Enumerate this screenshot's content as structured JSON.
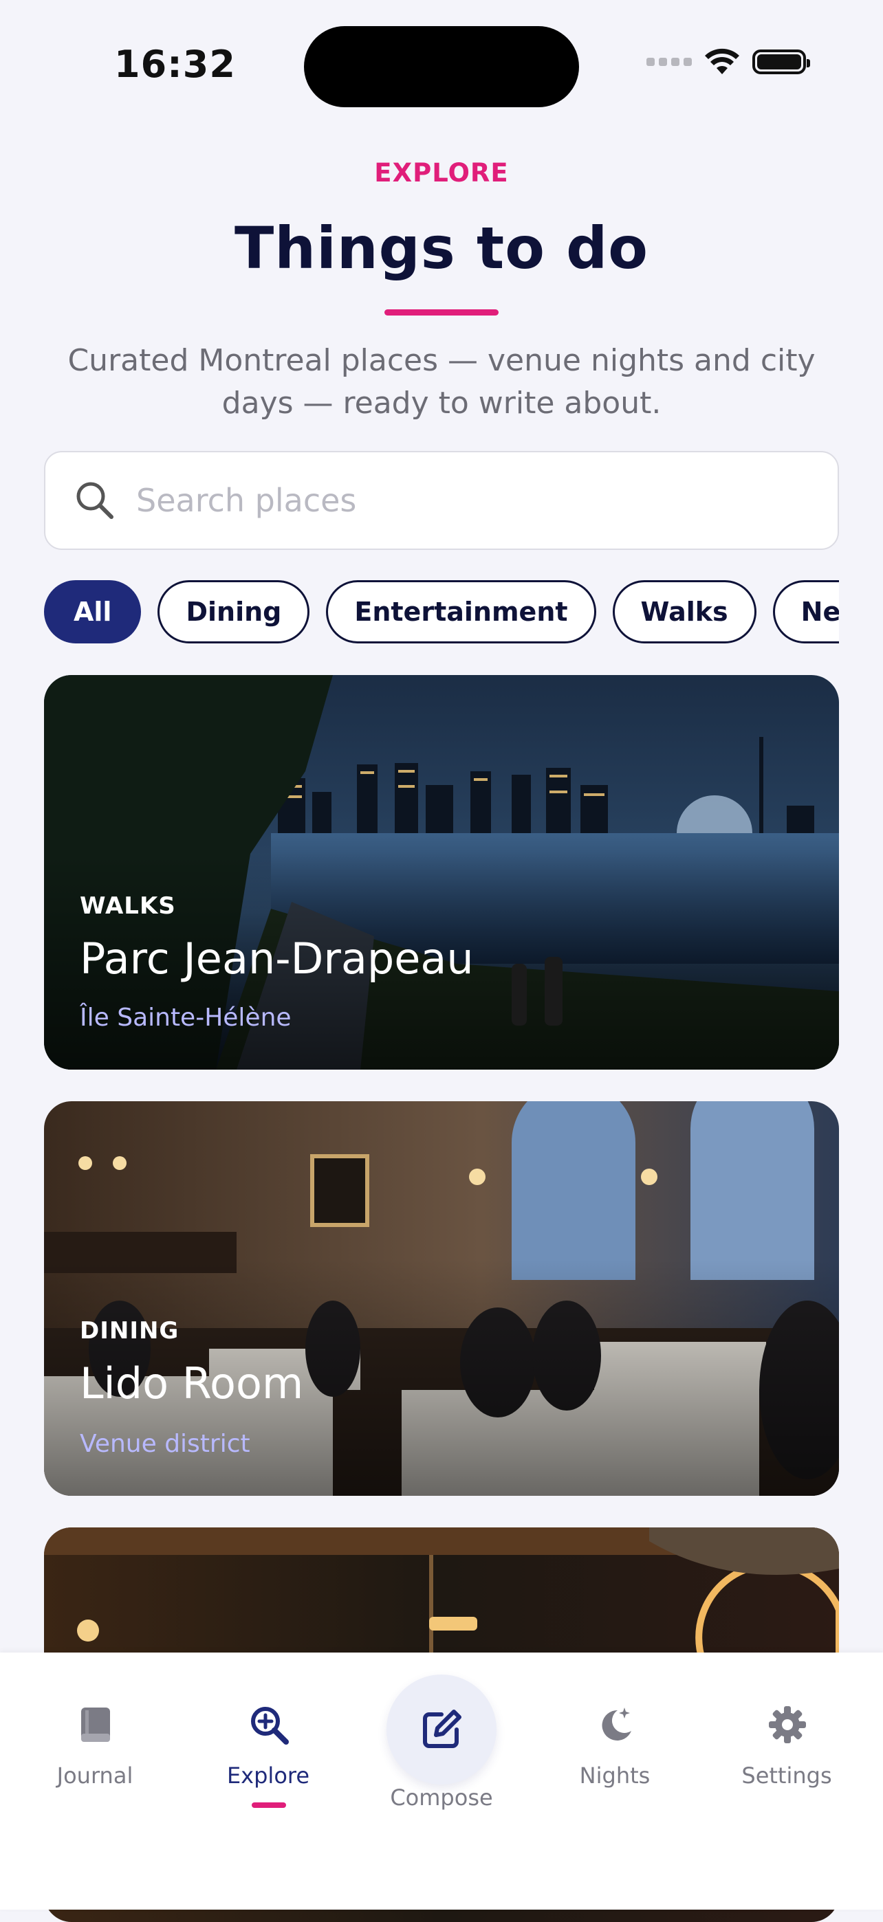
{
  "status_bar": {
    "time": "16:32"
  },
  "header": {
    "kicker": "EXPLORE",
    "title": "Things to do",
    "subtitle": "Curated Montreal places — venue nights and city days — ready to write about."
  },
  "search": {
    "placeholder": "Search places",
    "value": ""
  },
  "filters": [
    "All",
    "Dining",
    "Entertainment",
    "Walks",
    "Neighborhoods"
  ],
  "selected_filter": "All",
  "places": [
    {
      "category": "WALKS",
      "name": "Parc Jean-Drapeau",
      "location": "Île Sainte-Hélène"
    },
    {
      "category": "DINING",
      "name": "Lido Room",
      "location": "Venue district"
    }
  ],
  "tab_bar": {
    "items": [
      {
        "label": "Journal",
        "icon": "book-icon"
      },
      {
        "label": "Explore",
        "icon": "search-plus-icon",
        "active": true
      },
      {
        "label": "Compose",
        "icon": "compose-icon"
      },
      {
        "label": "Nights",
        "icon": "moon-stars-icon"
      },
      {
        "label": "Settings",
        "icon": "gear-icon"
      }
    ]
  },
  "colors": {
    "accent": "#e01e7a",
    "primary": "#1f2a7a",
    "ink": "#0e1238",
    "background": "#f4f4fa"
  }
}
